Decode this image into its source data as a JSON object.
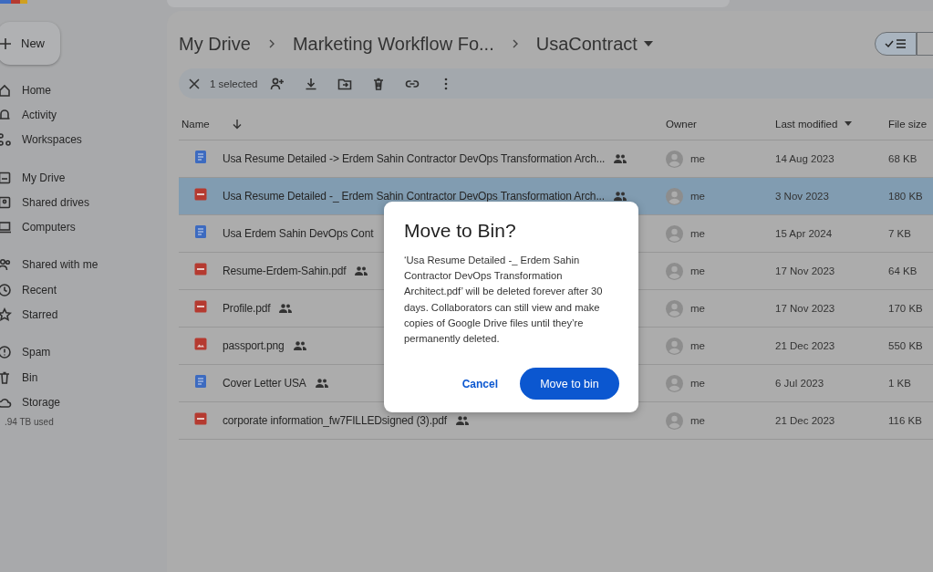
{
  "sidebar": {
    "new_button": "New",
    "groups": [
      [
        {
          "label": "Home"
        },
        {
          "label": "Activity"
        },
        {
          "label": "Workspaces"
        }
      ],
      [
        {
          "label": "My Drive"
        },
        {
          "label": "Shared drives"
        },
        {
          "label": "Computers"
        }
      ],
      [
        {
          "label": "Shared with me"
        },
        {
          "label": "Recent"
        },
        {
          "label": "Starred"
        }
      ],
      [
        {
          "label": "Spam"
        },
        {
          "label": "Bin"
        },
        {
          "label": "Storage"
        }
      ]
    ],
    "storage_used": ".94 TB used"
  },
  "breadcrumbs": [
    {
      "label": "My Drive"
    },
    {
      "label": "Marketing Workflow Fo..."
    },
    {
      "label": "UsaContract"
    }
  ],
  "view_toggle": {
    "list_selected": true
  },
  "selection_bar": {
    "count": "1 selected"
  },
  "table": {
    "columns": [
      {
        "label": "Name",
        "sorted": true,
        "has_menu": false
      },
      {
        "label": "Owner",
        "sorted": false,
        "has_menu": false
      },
      {
        "label": "Last modified",
        "sorted": false,
        "has_menu": true
      },
      {
        "label": "File size",
        "sorted": false,
        "has_menu": false
      }
    ],
    "rows": [
      {
        "name": "Usa Resume Detailed -> Erdem Sahin Contractor DevOps Transformation Arch...",
        "kind": "doc",
        "shared": true,
        "owner": "me",
        "modified": "14 Aug 2023",
        "size": "68 KB",
        "selected": false
      },
      {
        "name": "Usa Resume Detailed -_ Erdem Sahin Contractor DevOps Transformation Arch...",
        "kind": "pdf",
        "shared": true,
        "owner": "me",
        "modified": "3 Nov 2023",
        "size": "180 KB",
        "selected": true
      },
      {
        "name": "Usa Erdem Sahin DevOps Cont",
        "kind": "doc",
        "shared": false,
        "owner": "me",
        "modified": "15 Apr 2024",
        "size": "7 KB",
        "selected": false
      },
      {
        "name": "Resume-Erdem-Sahin.pdf",
        "kind": "pdf",
        "shared": true,
        "owner": "me",
        "modified": "17 Nov 2023",
        "size": "64 KB",
        "selected": false
      },
      {
        "name": "Profile.pdf",
        "kind": "pdf",
        "shared": true,
        "owner": "me",
        "modified": "17 Nov 2023",
        "size": "170 KB",
        "selected": false
      },
      {
        "name": "passport.png",
        "kind": "image",
        "shared": true,
        "owner": "me",
        "modified": "21 Dec 2023",
        "size": "550 KB",
        "selected": false
      },
      {
        "name": "Cover Letter USA",
        "kind": "doc",
        "shared": true,
        "owner": "me",
        "modified": "6 Jul 2023",
        "size": "1 KB",
        "selected": false
      },
      {
        "name": "corporate information_fw7FILLEDsigned (3).pdf",
        "kind": "pdf",
        "shared": true,
        "owner": "me",
        "modified": "21 Dec 2023",
        "size": "116 KB",
        "selected": false
      }
    ]
  },
  "dialog": {
    "title": "Move to Bin?",
    "message": "‘Usa Resume Detailed -_ Erdem Sahin Contractor DevOps Transformation Architect.pdf’ will be deleted forever after 30 days. Collaborators can still view and make copies of Google Drive files until they’re permanently deleted.",
    "buttons": [
      {
        "label": "Cancel",
        "kind": "text"
      },
      {
        "label": "Move to bin",
        "kind": "filled"
      }
    ]
  }
}
